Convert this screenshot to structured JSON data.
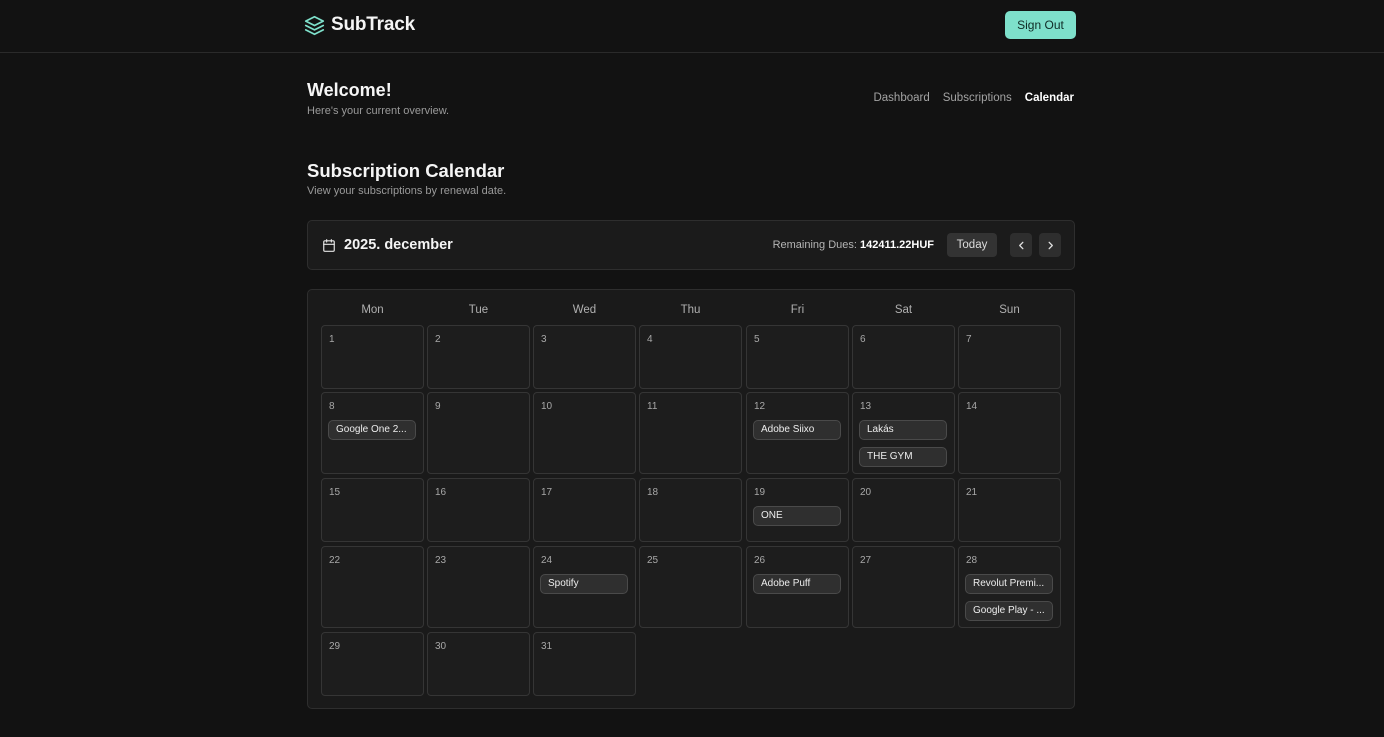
{
  "header": {
    "brand": "SubTrack",
    "brand_icon": "layers-icon",
    "sign_out_label": "Sign Out",
    "accent_color": "#7ee0cb"
  },
  "welcome": {
    "title": "Welcome!",
    "subtitle": "Here's your current overview."
  },
  "nav": {
    "items": [
      {
        "label": "Dashboard",
        "active": false
      },
      {
        "label": "Subscriptions",
        "active": false
      },
      {
        "label": "Calendar",
        "active": true
      }
    ]
  },
  "section": {
    "title": "Subscription Calendar",
    "subtitle": "View your subscriptions by renewal date."
  },
  "month_bar": {
    "icon": "calendar-icon",
    "month_label": "2025. december",
    "remaining_label": "Remaining Dues:",
    "remaining_value": "142411.22HUF",
    "today_label": "Today",
    "prev_icon": "chevron-left-icon",
    "next_icon": "chevron-right-icon"
  },
  "calendar": {
    "weekdays": [
      "Mon",
      "Tue",
      "Wed",
      "Thu",
      "Fri",
      "Sat",
      "Sun"
    ],
    "first_weekday_index": 0,
    "days_in_month": 31,
    "events": [
      {
        "day": 8,
        "label": "Google One 2..."
      },
      {
        "day": 12,
        "label": "Adobe Siixo"
      },
      {
        "day": 13,
        "label": "Lakás"
      },
      {
        "day": 13,
        "label": "THE GYM"
      },
      {
        "day": 19,
        "label": "ONE"
      },
      {
        "day": 24,
        "label": "Spotify"
      },
      {
        "day": 26,
        "label": "Adobe Puff"
      },
      {
        "day": 28,
        "label": "Revolut Premi..."
      },
      {
        "day": 28,
        "label": "Google Play - ..."
      }
    ]
  }
}
